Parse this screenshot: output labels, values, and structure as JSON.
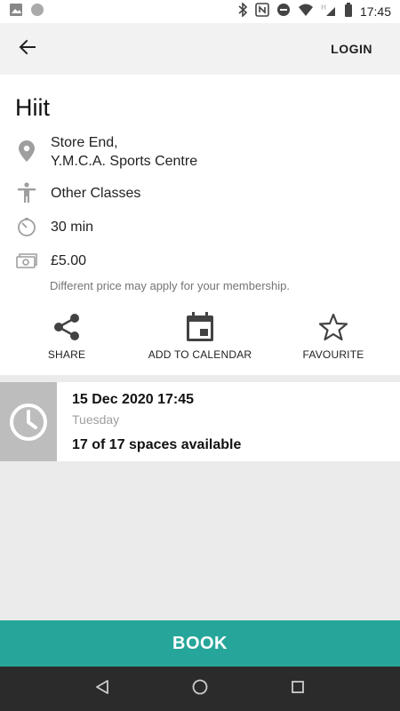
{
  "status_bar": {
    "time": "17:45",
    "icons": [
      "image-icon",
      "circle-icon",
      "bluetooth-icon",
      "nfc-icon",
      "do-not-disturb-icon",
      "wifi-icon",
      "signal-icon",
      "battery-icon"
    ]
  },
  "app_bar": {
    "back_icon": "arrow-back-icon",
    "login_label": "LOGIN"
  },
  "class": {
    "title": "Hiit",
    "location_line1": "Store End,",
    "location_line2": "Y.M.C.A. Sports Centre",
    "category": "Other Classes",
    "duration": "30 min",
    "price": "£5.00",
    "price_note": "Different price may apply for your membership."
  },
  "actions": {
    "share": "SHARE",
    "add_to_calendar": "ADD TO CALENDAR",
    "favourite": "FAVOURITE"
  },
  "session": {
    "datetime": "15 Dec 2020 17:45",
    "day": "Tuesday",
    "spaces": "17 of 17 spaces available"
  },
  "book": {
    "label": "BOOK"
  },
  "colors": {
    "accent": "#26a69a",
    "icon_grey": "#9e9e9e",
    "clock_block": "#bdbdbd"
  }
}
